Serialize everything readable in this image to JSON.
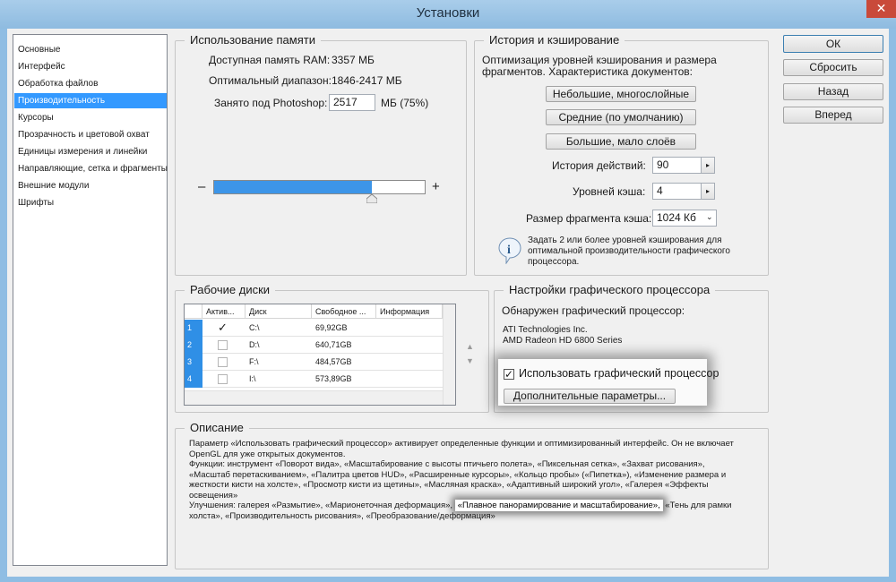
{
  "window": {
    "title": "Установки",
    "close_glyph": "✕"
  },
  "nav": {
    "items": [
      {
        "label": "Основные"
      },
      {
        "label": "Интерфейс"
      },
      {
        "label": "Обработка файлов"
      },
      {
        "label": "Производительность",
        "selected": true
      },
      {
        "label": "Курсоры"
      },
      {
        "label": "Прозрачность и цветовой охват"
      },
      {
        "label": "Единицы измерения и линейки"
      },
      {
        "label": "Направляющие, сетка и фрагменты"
      },
      {
        "label": "Внешние модули"
      },
      {
        "label": "Шрифты"
      }
    ]
  },
  "buttons": {
    "ok": "ОК",
    "reset": "Сбросить",
    "back": "Назад",
    "forward": "Вперед"
  },
  "memory": {
    "title": "Использование памяти",
    "ram_label": "Доступная память RAM:",
    "ram_value": "3357 МБ",
    "range_label": "Оптимальный диапазон:",
    "range_value": "1846-2417 МБ",
    "usage_label": "Занято под Photoshop:",
    "usage_value": "2517",
    "usage_suffix": "МБ (75%)",
    "slider_percent": 75,
    "minus": "–",
    "plus": "+"
  },
  "history": {
    "title": "История и кэширование",
    "desc_line1": "Оптимизация уровней кэширования и размера",
    "desc_line2": "фрагментов. Характеристика документов:",
    "preset_small": "Небольшие, многослойные",
    "preset_default": "Средние (по умолчанию)",
    "preset_large": "Большие, мало слоёв",
    "history_label": "История действий:",
    "history_value": "90",
    "cache_label": "Уровней кэша:",
    "cache_value": "4",
    "tile_label": "Размер фрагмента кэша:",
    "tile_value": "1024 Кб",
    "info_line1": "Задать 2 или более уровней кэширования для",
    "info_line2": "оптимальной производительности графического",
    "info_line3": "процессора."
  },
  "scratch": {
    "title": "Рабочие диски",
    "headers": [
      "Актив...",
      "Диск",
      "Свободное ...",
      "Информация"
    ],
    "rows": [
      {
        "num": "1",
        "active": true,
        "disk": "C:\\",
        "free": "69,92GB"
      },
      {
        "num": "2",
        "active": false,
        "disk": "D:\\",
        "free": "640,71GB"
      },
      {
        "num": "3",
        "active": false,
        "disk": "F:\\",
        "free": "484,57GB"
      },
      {
        "num": "4",
        "active": false,
        "disk": "I:\\",
        "free": "573,89GB"
      }
    ]
  },
  "gpu": {
    "title": "Настройки графического процессора",
    "detected_label": "Обнаружен графический процессор:",
    "vendor": "ATI Technologies Inc.",
    "model": "AMD Radeon HD 6800 Series",
    "use_gpu_label": "Использовать графический процессор",
    "use_gpu_checked": true,
    "advanced_label": "Дополнительные параметры..."
  },
  "description": {
    "title": "Описание",
    "line1": "Параметр «Использовать графический процессор» активирует определенные функции и оптимизированный интерфейс. Он не включает",
    "line2": "OpenGL для уже открытых документов.",
    "line3": "Функции: инструмент «Поворот вида», «Масштабирование с высоты птичьего полета», «Пиксельная сетка», «Захват рисования»,",
    "line4": "«Масштаб перетаскиванием», «Палитра цветов HUD», «Расширенные курсоры», «Кольцо пробы» («Пипетка»), «Изменение размера и",
    "line5": "жесткости кисти на холсте», «Просмотр кисти из щетины», «Масляная краска», «Адаптивный широкий угол», «Галерея «Эффекты",
    "line6": "освещения»",
    "line7_a": "Улучшения: галерея «Размытие», «Марионеточная деформация»,",
    "line7_highlight": "«Плавное панорамирование и масштабирование»,",
    "line7_b": "«Тень для рамки",
    "line8": "холста», «Производительность рисования», «Преобразование/деформация»"
  }
}
